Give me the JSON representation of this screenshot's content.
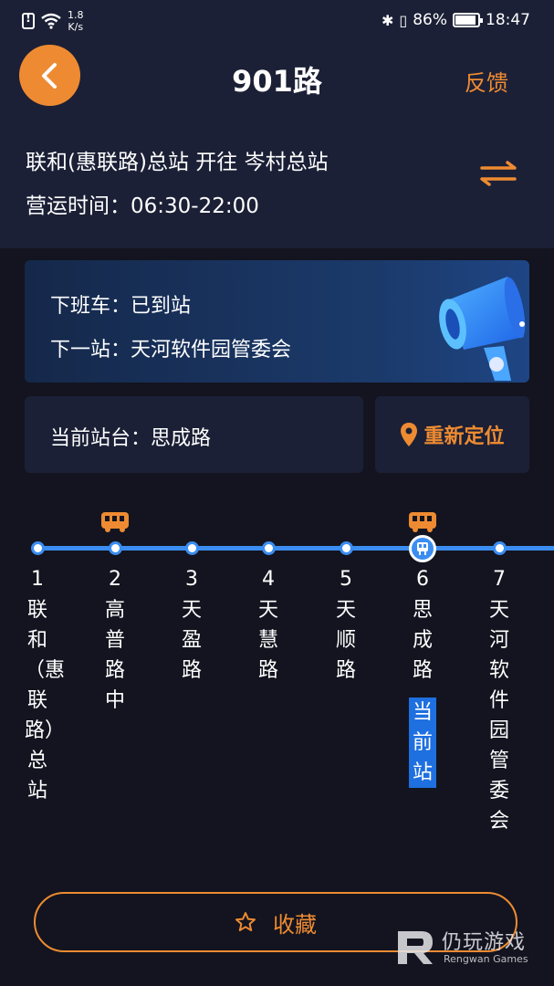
{
  "status_bar": {
    "net_speed_value": "1.8",
    "net_speed_unit": "K/s",
    "battery": "86%",
    "time": "18:47"
  },
  "header": {
    "title": "901路",
    "feedback": "反馈"
  },
  "route": {
    "direction": "联和(惠联路)总站 开往 岑村总站",
    "hours": "营运时间：06:30-22:00"
  },
  "arrival": {
    "next_bus": "下班车：已到站",
    "next_stop": "下一站：天河软件园管委会"
  },
  "current_stop": {
    "label": "当前站台：思成路",
    "relocate": "重新定位"
  },
  "stops": [
    {
      "num": "1",
      "name": "联和（惠联路）总站",
      "bus": false,
      "current": false
    },
    {
      "num": "2",
      "name": "高普路中",
      "bus": true,
      "current": false
    },
    {
      "num": "3",
      "name": "天盈路",
      "bus": false,
      "current": false
    },
    {
      "num": "4",
      "name": "天慧路",
      "bus": false,
      "current": false
    },
    {
      "num": "5",
      "name": "天顺路",
      "bus": false,
      "current": false
    },
    {
      "num": "6",
      "name": "思成路",
      "bus": true,
      "current": true
    },
    {
      "num": "7",
      "name": "天河软件园管委会",
      "bus": false,
      "current": false
    }
  ],
  "current_tag": "当前站",
  "favorite": "收藏",
  "watermark": {
    "cn": "仍玩游戏",
    "en": "Rengwan Games"
  },
  "colors": {
    "accent": "#ee8b32",
    "line": "#3b8df1",
    "background": "#13141f",
    "panel": "#1b2036"
  }
}
